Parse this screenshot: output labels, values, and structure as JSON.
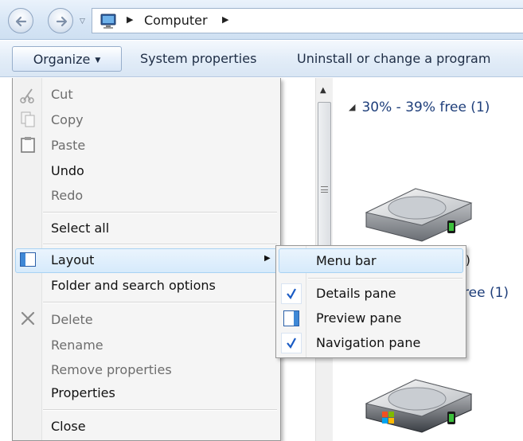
{
  "address": {
    "breadcrumb": "Computer"
  },
  "command_bar": {
    "organize": "Organize",
    "system_properties": "System properties",
    "uninstall": "Uninstall or change a program"
  },
  "content": {
    "group1_header": "30% - 39% free (1)",
    "drive1_label_fragment": ":)",
    "group2_header_fragment": "ree (1)"
  },
  "organize_menu": {
    "items": [
      {
        "label": "Cut",
        "enabled": false,
        "icon": "scissors-icon"
      },
      {
        "label": "Copy",
        "enabled": false,
        "icon": "copy-icon"
      },
      {
        "label": "Paste",
        "enabled": false,
        "icon": "paste-icon"
      },
      {
        "label": "Undo",
        "enabled": true
      },
      {
        "label": "Redo",
        "enabled": false
      },
      {
        "label": "Select all",
        "enabled": true
      },
      {
        "label": "Layout",
        "enabled": true,
        "icon": "layout-icon",
        "submenu": true,
        "highlighted": true
      },
      {
        "label": "Folder and search options",
        "enabled": true
      },
      {
        "label": "Delete",
        "enabled": false,
        "icon": "delete-x-icon"
      },
      {
        "label": "Rename",
        "enabled": false
      },
      {
        "label": "Remove properties",
        "enabled": false
      },
      {
        "label": "Properties",
        "enabled": true
      },
      {
        "label": "Close",
        "enabled": true
      }
    ]
  },
  "layout_submenu": {
    "items": [
      {
        "label": "Menu bar",
        "checked": false,
        "highlighted": true
      },
      {
        "label": "Details pane",
        "checked": true
      },
      {
        "label": "Preview pane",
        "checked": false,
        "icon": "preview-pane-icon"
      },
      {
        "label": "Navigation pane",
        "checked": true
      }
    ]
  },
  "colors": {
    "highlight_border": "#a8d2f3",
    "group_header": "#1e3e7a",
    "check": "#1a5bc4"
  }
}
